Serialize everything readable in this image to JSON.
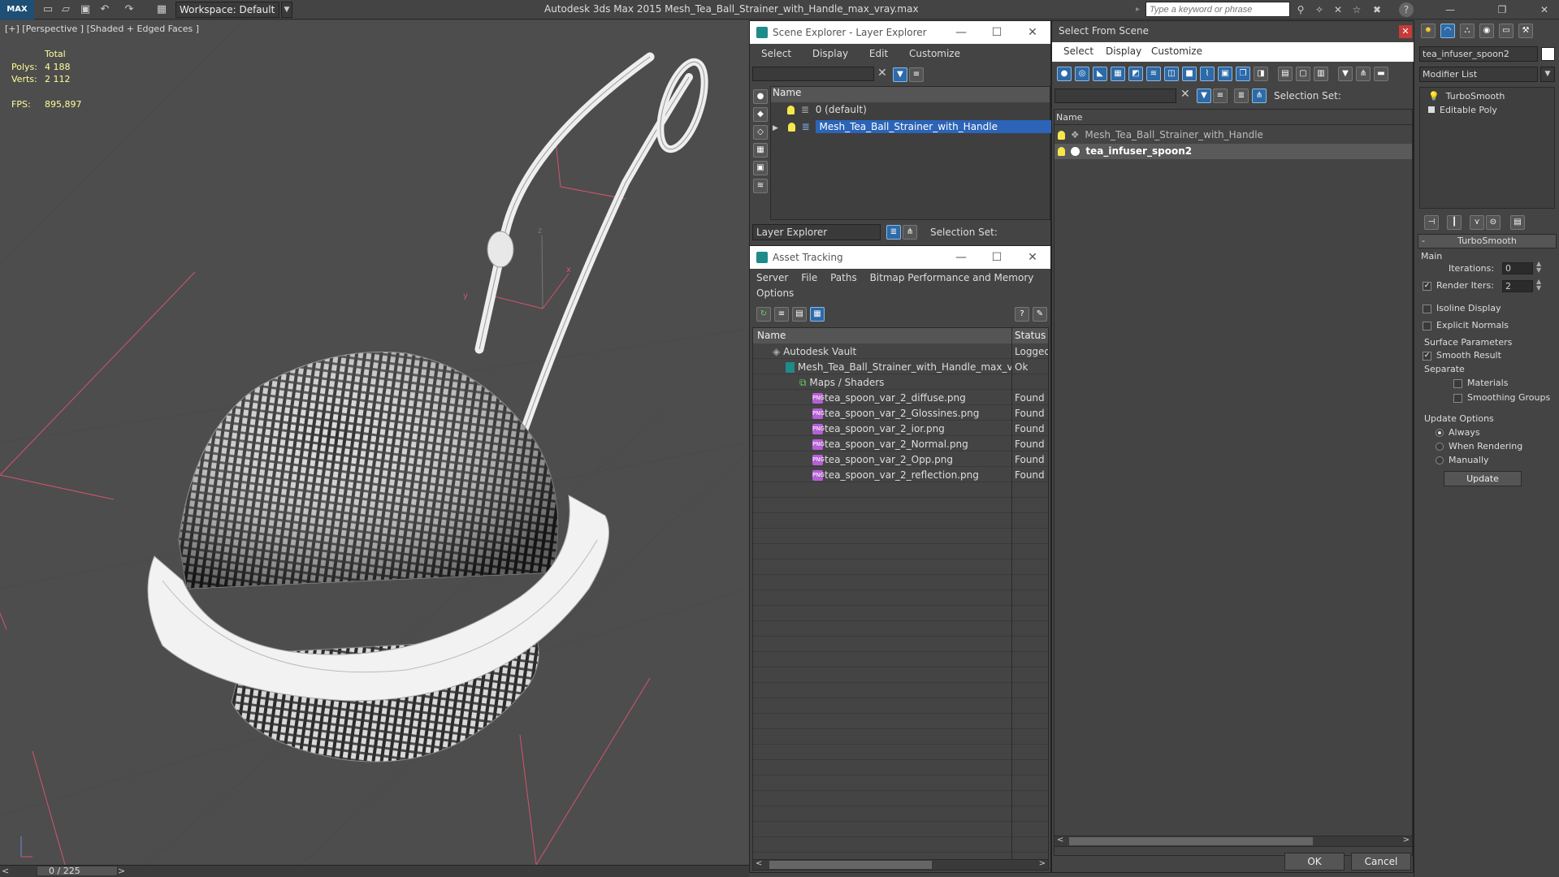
{
  "app": {
    "logo": "MAX",
    "workspace": "Workspace: Default",
    "title": "Autodesk 3ds Max  2015     Mesh_Tea_Ball_Strainer_with_Handle_max_vray.max",
    "search_placeholder": "Type a keyword or phrase"
  },
  "viewport": {
    "label": "[+] [Perspective ] [Shaded + Edged Faces ]",
    "stats_header": "Total",
    "polys_label": "Polys:",
    "polys_value": "4 188",
    "verts_label": "Verts:",
    "verts_value": "2 112",
    "fps_label": "FPS:",
    "fps_value": "895,897",
    "axis_x": "x",
    "axis_y": "y",
    "axis_z": "z"
  },
  "timeline": {
    "frame": "0 / 225"
  },
  "scene_explorer": {
    "title": "Scene Explorer - Layer Explorer",
    "menus": [
      "Select",
      "Display",
      "Edit",
      "Customize"
    ],
    "column": "Name",
    "layers": [
      "0 (default)",
      "Mesh_Tea_Ball_Strainer_with_Handle"
    ],
    "footer_dropdown": "Layer Explorer",
    "selection_set": "Selection Set:"
  },
  "asset_tracking": {
    "title": "Asset Tracking",
    "menus": [
      "Server",
      "File",
      "Paths",
      "Bitmap Performance and Memory"
    ],
    "menu2": "Options",
    "col_name": "Name",
    "col_status": "Status",
    "rows": [
      {
        "name": "Autodesk Vault",
        "status": "Logged"
      },
      {
        "name": "Mesh_Tea_Ball_Strainer_with_Handle_max_vray....",
        "status": "Ok"
      },
      {
        "name": "Maps / Shaders",
        "status": ""
      },
      {
        "name": "tea_spoon_var_2_diffuse.png",
        "status": "Found"
      },
      {
        "name": "tea_spoon_var_2_Glossines.png",
        "status": "Found"
      },
      {
        "name": "tea_spoon_var_2_ior.png",
        "status": "Found"
      },
      {
        "name": "tea_spoon_var_2_Normal.png",
        "status": "Found"
      },
      {
        "name": "tea_spoon_var_2_Opp.png",
        "status": "Found"
      },
      {
        "name": "tea_spoon_var_2_reflection.png",
        "status": "Found"
      }
    ]
  },
  "select_from_scene": {
    "title": "Select From Scene",
    "menus": [
      "Select",
      "Display",
      "Customize"
    ],
    "selection_set": "Selection Set:",
    "column": "Name",
    "objects": [
      "Mesh_Tea_Ball_Strainer_with_Handle",
      "tea_infuser_spoon2"
    ],
    "ok": "OK",
    "cancel": "Cancel"
  },
  "modify_panel": {
    "object_name": "tea_infuser_spoon2",
    "modifier_list": "Modifier List",
    "stack": [
      "TurboSmooth",
      "Editable Poly"
    ],
    "rollout": "TurboSmooth",
    "main": "Main",
    "iterations_label": "Iterations:",
    "iterations": "0",
    "render_iters_label": "Render Iters:",
    "render_iters": "2",
    "isoline": "Isoline Display",
    "explicit_normals": "Explicit Normals",
    "surface_params": "Surface Parameters",
    "smooth_result": "Smooth Result",
    "separate": "Separate",
    "materials": "Materials",
    "smoothing_groups": "Smoothing Groups",
    "update_options": "Update Options",
    "always": "Always",
    "when_rendering": "When Rendering",
    "manually": "Manually",
    "update": "Update"
  },
  "colors": {
    "accent": "#2d6aa8",
    "selection": "#2b64b8",
    "bulb": "#f6e84a"
  }
}
